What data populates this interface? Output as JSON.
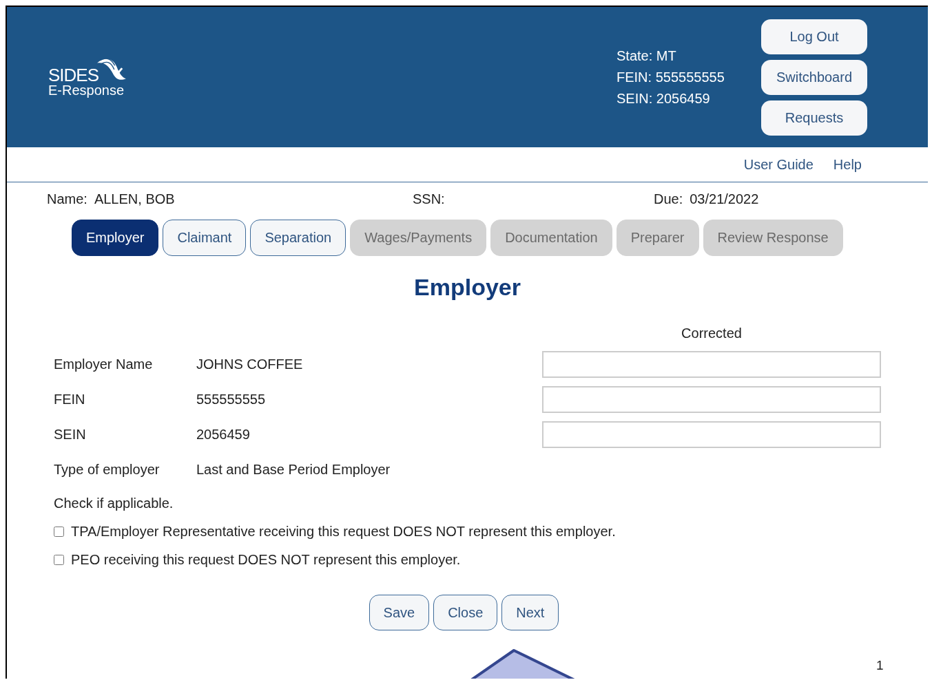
{
  "header": {
    "logo": {
      "title": "SIDES",
      "subtitle": "E-Response"
    },
    "info": [
      "State: MT",
      "FEIN: 555555555",
      "SEIN: 2056459"
    ],
    "buttons": [
      "Log Out",
      "Switchboard",
      "Requests"
    ]
  },
  "links": [
    "User Guide",
    "Help"
  ],
  "claim": [
    {
      "label": "Name:",
      "value": "ALLEN, BOB"
    },
    {
      "label": "SSN:"
    },
    {
      "label": "Due:",
      "value": "03/21/2022"
    }
  ],
  "tabs": [
    {
      "label": "Employer",
      "selected": true,
      "disabled": false
    },
    {
      "label": "Claimant",
      "selected": false,
      "disabled": false
    },
    {
      "label": "Separation",
      "selected": false,
      "disabled": false
    },
    {
      "label": "Wages/Payments",
      "selected": false,
      "disabled": true
    },
    {
      "label": "Documentation",
      "selected": false,
      "disabled": true
    },
    {
      "label": "Preparer",
      "selected": false,
      "disabled": true
    },
    {
      "label": "Review Response",
      "selected": false,
      "disabled": true
    }
  ],
  "section_title": "Employer",
  "corrected_heading": "Corrected",
  "fields": [
    {
      "label": "Employer Name",
      "value": "JOHNS COFFEE",
      "editable": true
    },
    {
      "label": "FEIN",
      "value": "555555555",
      "editable": true
    },
    {
      "label": "SEIN",
      "value": "2056459",
      "editable": true
    },
    {
      "label": "Type of employer",
      "value": "Last and Base Period Employer",
      "editable": false
    }
  ],
  "check_heading": "Check if applicable.",
  "checks": [
    {
      "label": "TPA/Employer Representative receiving this request DOES NOT represent this employer.",
      "checked": false
    },
    {
      "label": "PEO receiving this request DOES NOT represent this employer.",
      "checked": false
    }
  ],
  "actions": [
    "Save",
    "Close",
    "Next"
  ],
  "page_number": "1"
}
